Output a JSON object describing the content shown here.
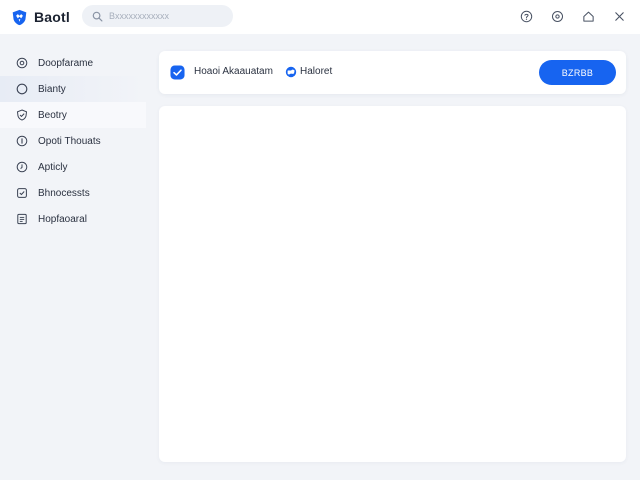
{
  "app": {
    "name": "Baotl",
    "logo_icon": "shield-logo-icon",
    "accent_color": "#1764f0"
  },
  "search": {
    "placeholder": "Bxxxxxxxxxxxx",
    "value": "",
    "icon": "search-icon"
  },
  "header_actions": [
    {
      "name": "help-button",
      "icon": "help-circle-icon"
    },
    {
      "name": "settings-button",
      "icon": "gear-icon"
    },
    {
      "name": "home-button",
      "icon": "home-icon"
    },
    {
      "name": "close-button",
      "icon": "close-icon"
    }
  ],
  "sidebar": {
    "items": [
      {
        "label": "Doopfarame",
        "icon": "target-icon",
        "state": "normal"
      },
      {
        "label": "Bianty",
        "icon": "circle-icon",
        "state": "selected"
      },
      {
        "label": "Beotry",
        "icon": "shield-icon",
        "state": "hover"
      },
      {
        "label": "Opoti Thouats",
        "icon": "info-icon",
        "state": "normal"
      },
      {
        "label": "Apticly",
        "icon": "clock-icon",
        "state": "normal"
      },
      {
        "label": "Bhnocessts",
        "icon": "box-check-icon",
        "state": "normal"
      },
      {
        "label": "Hopfaoaral",
        "icon": "document-icon",
        "state": "normal"
      }
    ]
  },
  "banner": {
    "text": "Hoaoi Akaauatam",
    "tag": "Haloret",
    "check_icon": "check-badge-icon",
    "chip_icon": "globe-icon",
    "button_label": "BZRBB"
  },
  "content": {}
}
